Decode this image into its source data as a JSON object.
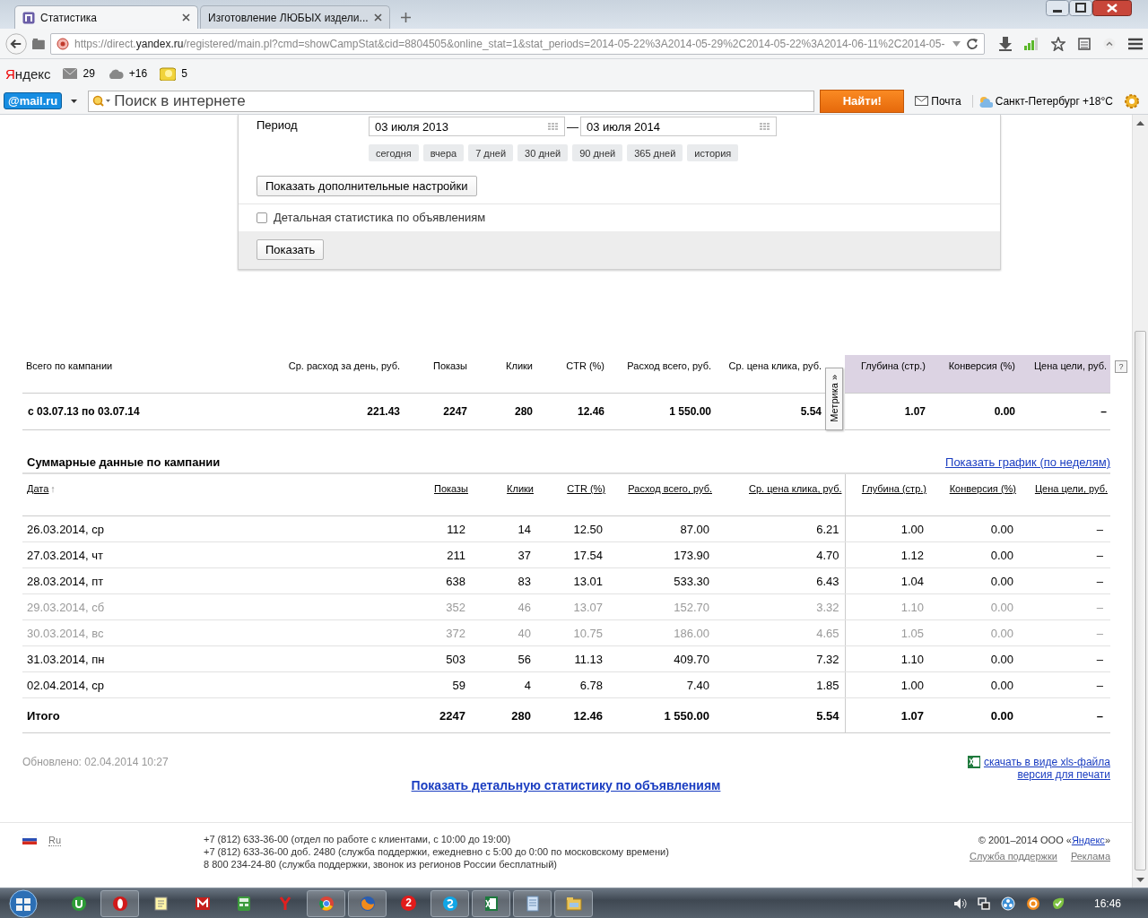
{
  "browser": {
    "tabs": [
      {
        "title": "Статистика",
        "selected": true
      },
      {
        "title": "Изготовление ЛЮБЫХ издели...",
        "selected": false
      }
    ],
    "url": "https://direct.**yandex.ru**/registered/main.pl?cmd=showCampStat&cid=8804505&online_stat=1&stat_periods=2014-05-22%3A2014-05-29%2C2014-05-22%3A2014-06-11%2C2014-05-"
  },
  "yandex_bar": {
    "brand": "Яндекс",
    "mail_count": "29",
    "temperature": "+16",
    "counter": "5"
  },
  "mail_bar": {
    "logo": "@mail.ru",
    "placeholder": "Поиск в интернете",
    "search_button": "Найти!",
    "mail_link": "Почта",
    "weather": "Санкт-Петербург +18°С"
  },
  "form": {
    "period_label": "Период",
    "date_from": "03 июля 2013",
    "separator": "—",
    "date_to": "03 июля 2014",
    "presets": [
      "сегодня",
      "вчера",
      "7 дней",
      "30 дней",
      "90 дней",
      "365 дней",
      "история"
    ],
    "more_settings": "Показать дополнительные настройки",
    "detailed": {
      "label": "Детальная статистика по объявлениям",
      "checked": false
    },
    "submit": "Показать"
  },
  "summary": {
    "columns": [
      {
        "label": "Всего по кампании",
        "highlighted": false
      },
      {
        "label": "Ср. расход за день, руб.",
        "highlighted": false
      },
      {
        "label": "Показы",
        "highlighted": false
      },
      {
        "label": "Клики",
        "highlighted": false
      },
      {
        "label": "CTR (%)",
        "highlighted": false
      },
      {
        "label": "Расход всего, руб.",
        "highlighted": false
      },
      {
        "label": "Ср. цена клика, руб.",
        "highlighted": false
      },
      {
        "label": "Глубина (стр.)",
        "highlighted": true
      },
      {
        "label": "Конверсия (%)",
        "highlighted": true
      },
      {
        "label": "Цена цели, руб.",
        "highlighted": true
      }
    ],
    "metrika_tab": "Метрика »",
    "help": "?",
    "row": [
      "с 03.07.13 по 03.07.14",
      "221.43",
      "2247",
      "280",
      "12.46",
      "1 550.00",
      "5.54",
      "1.07",
      "0.00",
      "–"
    ]
  },
  "daily": {
    "title": "Суммарные данные по кампании",
    "chart_link": "Показать график (по неделям)",
    "columns": [
      {
        "label": "Дата",
        "sort_mark": "↑"
      },
      {
        "label": "Показы"
      },
      {
        "label": "Клики"
      },
      {
        "label": "CTR (%)"
      },
      {
        "label": "Расход всего, руб."
      },
      {
        "label": "Ср. цена клика, руб."
      },
      {
        "label": "Глубина (стр.)"
      },
      {
        "label": "Конверсия (%)"
      },
      {
        "label": "Цена цели, руб."
      }
    ],
    "rows": [
      {
        "muted": false,
        "cells": [
          "26.03.2014, ср",
          "112",
          "14",
          "12.50",
          "87.00",
          "6.21",
          "1.00",
          "0.00",
          "–"
        ]
      },
      {
        "muted": false,
        "cells": [
          "27.03.2014, чт",
          "211",
          "37",
          "17.54",
          "173.90",
          "4.70",
          "1.12",
          "0.00",
          "–"
        ]
      },
      {
        "muted": false,
        "cells": [
          "28.03.2014, пт",
          "638",
          "83",
          "13.01",
          "533.30",
          "6.43",
          "1.04",
          "0.00",
          "–"
        ]
      },
      {
        "muted": true,
        "cells": [
          "29.03.2014, сб",
          "352",
          "46",
          "13.07",
          "152.70",
          "3.32",
          "1.10",
          "0.00",
          "–"
        ]
      },
      {
        "muted": true,
        "cells": [
          "30.03.2014, вс",
          "372",
          "40",
          "10.75",
          "186.00",
          "4.65",
          "1.05",
          "0.00",
          "–"
        ]
      },
      {
        "muted": false,
        "cells": [
          "31.03.2014, пн",
          "503",
          "56",
          "11.13",
          "409.70",
          "7.32",
          "1.10",
          "0.00",
          "–"
        ]
      },
      {
        "muted": false,
        "cells": [
          "02.04.2014, ср",
          "59",
          "4",
          "6.78",
          "7.40",
          "1.85",
          "1.00",
          "0.00",
          "–"
        ]
      }
    ],
    "total": [
      "Итого",
      "2247",
      "280",
      "12.46",
      "1 550.00",
      "5.54",
      "1.07",
      "0.00",
      "–"
    ]
  },
  "after": {
    "updated": "Обновлено: 02.04.2014 10:27",
    "xls_link": "скачать в виде xls-файла",
    "print_link": "версия для печати",
    "detail_link": "Показать детальную статистику по объявлениям"
  },
  "footer": {
    "lang": "Ru",
    "phones": [
      "+7 (812) 633-36-00 (отдел по работе с клиентами, с 10:00 до 19:00)",
      "+7 (812) 633-36-00 доб. 2480 (служба поддержки, ежедневно с 5:00 до 0:00 по московскому времени)",
      "8 800 234-24-80 (служба поддержки, звонок из регионов России бесплатный)"
    ],
    "copyright": {
      "before": "© 2001–2014  ООО «",
      "link": "Яндекс",
      "after": "»"
    },
    "links": [
      "Служба поддержки",
      "Реклама"
    ]
  },
  "taskbar": {
    "apps": [
      {
        "running": false
      },
      {
        "running": true
      },
      {
        "running": false
      },
      {
        "running": false
      },
      {
        "running": false
      },
      {
        "running": false
      },
      {
        "running": true
      },
      {
        "running": true
      },
      {
        "running": false
      },
      {
        "running": true
      },
      {
        "running": true
      },
      {
        "running": true
      },
      {
        "running": true
      }
    ],
    "badge": "2",
    "clock": "16:46"
  }
}
